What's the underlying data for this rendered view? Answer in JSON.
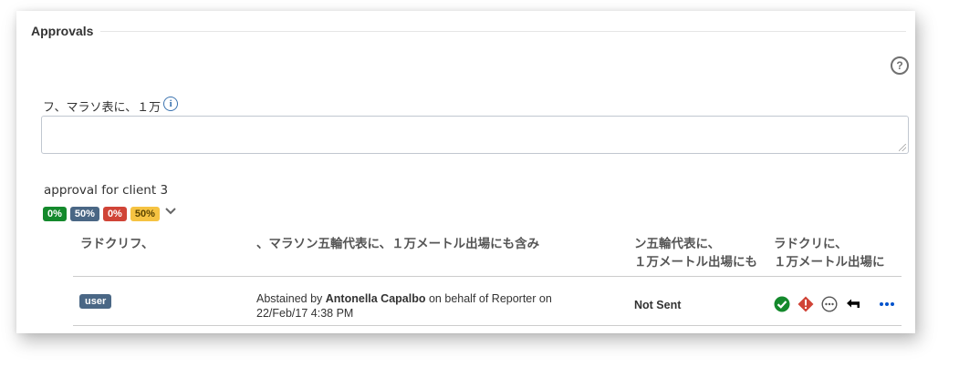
{
  "section": {
    "title": "Approvals"
  },
  "help": {
    "glyph": "?"
  },
  "field": {
    "label": "フ、マラソ表に、１万",
    "info_glyph": "i",
    "value": ""
  },
  "approval": {
    "name": "approval for client 3",
    "badges": [
      {
        "text": "0%",
        "color": "#14892c"
      },
      {
        "text": "50%",
        "color": "#4a6785"
      },
      {
        "text": "0%",
        "color": "#d04437"
      },
      {
        "text": "50%",
        "color": "#f6c342"
      }
    ]
  },
  "table": {
    "headers": [
      "ラドクリフ、",
      "、マラソン五輪代表に、１万メートル出場にも含み",
      "ン五輪代表に、",
      "１万メートル出場にも",
      "ラドクリに、",
      "１万メートル出場に"
    ],
    "row": {
      "role": "user",
      "desc_prefix": "Abstained by",
      "desc_name": "Antonella Capalbo",
      "desc_suffix": "on behalf of Reporter on",
      "desc_date": "22/Feb/17 4:38 PM",
      "status": "Not Sent",
      "action_icons": [
        "approve-icon",
        "reject-icon",
        "abstain-icon",
        "delegate-back-icon",
        "more-icon"
      ]
    }
  },
  "colors": {
    "accent": "#0052cc",
    "success": "#14892c",
    "error": "#d04437",
    "lozenge": "#4a6785"
  }
}
